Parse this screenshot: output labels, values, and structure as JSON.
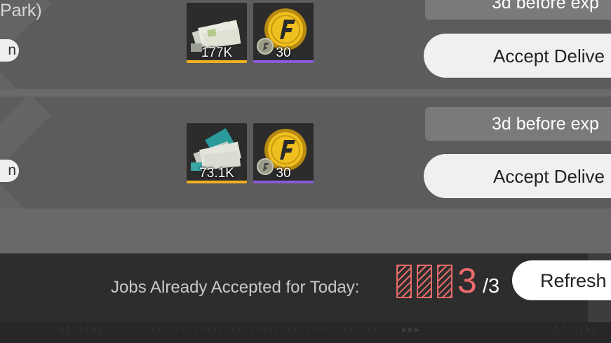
{
  "jobs": [
    {
      "title": "Park)",
      "pill_label": "n",
      "rewards": [
        {
          "icon": "ticket-bundle-icon",
          "quantity": "177K",
          "rarity_color": "#f0b020"
        },
        {
          "icon": "gold-coin-icon",
          "quantity": "30",
          "rarity_color": "#8a5ad8"
        }
      ],
      "expiry": "3d before exp",
      "accept_label": "Accept Delive"
    },
    {
      "title": "",
      "pill_label": "n",
      "rewards": [
        {
          "icon": "ticket-bundle-icon",
          "quantity": "73.1K",
          "rarity_color": "#f0b020"
        },
        {
          "icon": "gold-coin-icon",
          "quantity": "30",
          "rarity_color": "#8a5ad8"
        }
      ],
      "expiry": "3d before exp",
      "accept_label": "Accept Delive"
    }
  ],
  "footer": {
    "jobs_label": "Jobs Already Accepted for Today:",
    "accepted_count": "3",
    "max_count": "/3",
    "refresh_label": "Refresh",
    "accent_color": "#ee6b6b",
    "decor_left": "ᚢᚠ ᛊᛇᛋᚾ",
    "decor_middle": "··· ··· ·············· ·· ········ ···",
    "decor_arrows": "▶▶▶",
    "decor_right": "ᚢᚠ ᛊᛇᛋᚾ"
  }
}
